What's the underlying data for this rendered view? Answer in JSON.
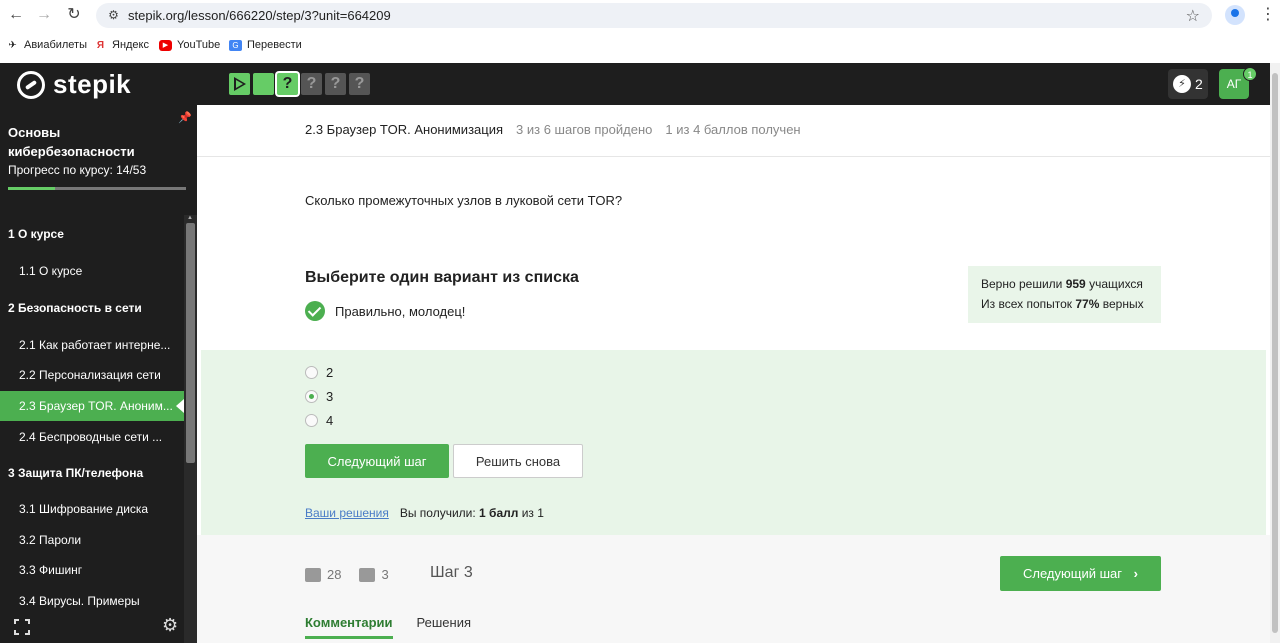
{
  "browser": {
    "url": "stepik.org/lesson/666220/step/3?unit=664209",
    "bookmarks": [
      {
        "label": "Авиабилеты",
        "icon": "plane-icon"
      },
      {
        "label": "Яндекс",
        "icon": "yandex-icon"
      },
      {
        "label": "YouTube",
        "icon": "youtube-icon"
      },
      {
        "label": "Перевести",
        "icon": "translate-icon"
      }
    ]
  },
  "header": {
    "logo": "stepik",
    "energy": "2",
    "avatar": "АГ",
    "notifications": "1",
    "step_marks": [
      "",
      "",
      "?",
      "?",
      "?",
      "?"
    ]
  },
  "sidebar": {
    "course_title": "Основы кибербезопасности",
    "progress_text": "Прогресс по курсу:  14/53",
    "progress_fraction": 0.264,
    "items": [
      {
        "label": "1  О курсе",
        "type": "section"
      },
      {
        "label": "1.1  О курсе",
        "type": "lesson"
      },
      {
        "label": "2  Безопасность в сети",
        "type": "section"
      },
      {
        "label": "2.1  Как работает интерне...",
        "type": "lesson"
      },
      {
        "label": "2.2  Персонализация сети",
        "type": "lesson"
      },
      {
        "label": "2.3  Браузер TOR. Аноним...",
        "type": "lesson",
        "active": true
      },
      {
        "label": "2.4  Беспроводные сети ...",
        "type": "lesson"
      },
      {
        "label": "3  Защита ПК/телефона",
        "type": "section"
      },
      {
        "label": "3.1  Шифрование диска",
        "type": "lesson"
      },
      {
        "label": "3.2  Пароли",
        "type": "lesson"
      },
      {
        "label": "3.3  Фишинг",
        "type": "lesson"
      },
      {
        "label": "3.4  Вирусы. Примеры",
        "type": "lesson"
      }
    ]
  },
  "lesson": {
    "title": "2.3 Браузер TOR. Анонимизация",
    "steps_done": "3 из 6 шагов пройдено",
    "points": "1 из 4 баллов  получен",
    "question": "Сколько промежуточных узлов в луковой сети TOR?",
    "choose_label": "Выберите один вариант из списка",
    "correct_msg": "Правильно, молодец!",
    "stats_line1_pre": "Верно решили ",
    "stats_solved": "959",
    "stats_line1_post": " учащихся",
    "stats_line2_pre": "Из всех попыток ",
    "stats_percent": "77%",
    "stats_line2_post": " верных",
    "options": [
      {
        "label": "2",
        "selected": false
      },
      {
        "label": "3",
        "selected": true
      },
      {
        "label": "4",
        "selected": false
      }
    ],
    "next_btn": "Следующий шаг",
    "retry_btn": "Решить снова",
    "solutions_link": "Ваши решения",
    "score_pre": "Вы получили: ",
    "score_value": "1 балл",
    "score_post": " из 1"
  },
  "footer": {
    "likes": "28",
    "dislikes": "3",
    "step_label": "Шаг 3",
    "next_btn": "Следующий шаг",
    "tabs": [
      "Комментарии",
      "Решения"
    ]
  }
}
